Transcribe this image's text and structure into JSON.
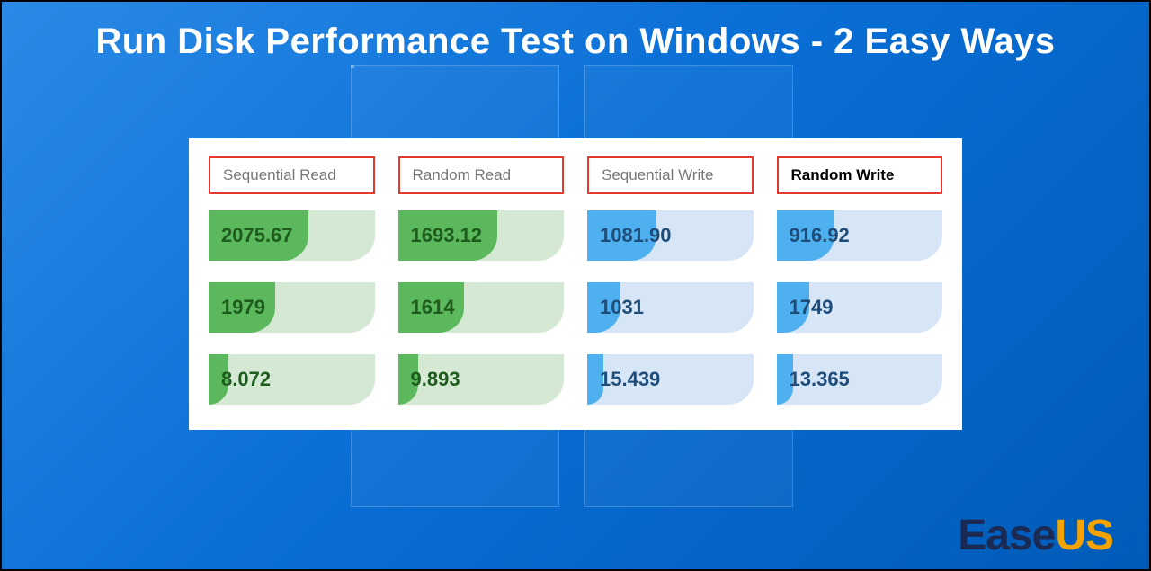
{
  "title": "Run Disk Performance Test on Windows - 2 Easy Ways",
  "brand": {
    "part1": "Ease",
    "part2": "US"
  },
  "activeColumnIndex": 3,
  "columns": [
    {
      "label": "Sequential Read",
      "kind": "read",
      "rows": [
        {
          "value": "2075.67",
          "fillPct": 60
        },
        {
          "value": "1979",
          "fillPct": 40
        },
        {
          "value": "8.072",
          "fillPct": 12
        }
      ]
    },
    {
      "label": "Random Read",
      "kind": "read",
      "rows": [
        {
          "value": "1693.12",
          "fillPct": 60
        },
        {
          "value": "1614",
          "fillPct": 40
        },
        {
          "value": "9.893",
          "fillPct": 12
        }
      ]
    },
    {
      "label": "Sequential Write",
      "kind": "write",
      "rows": [
        {
          "value": "1081.90",
          "fillPct": 42
        },
        {
          "value": "1031",
          "fillPct": 20
        },
        {
          "value": "15.439",
          "fillPct": 10
        }
      ]
    },
    {
      "label": "Random Write",
      "kind": "write",
      "rows": [
        {
          "value": "916.92",
          "fillPct": 35
        },
        {
          "value": "1749",
          "fillPct": 20
        },
        {
          "value": "13.365",
          "fillPct": 10
        }
      ]
    }
  ]
}
